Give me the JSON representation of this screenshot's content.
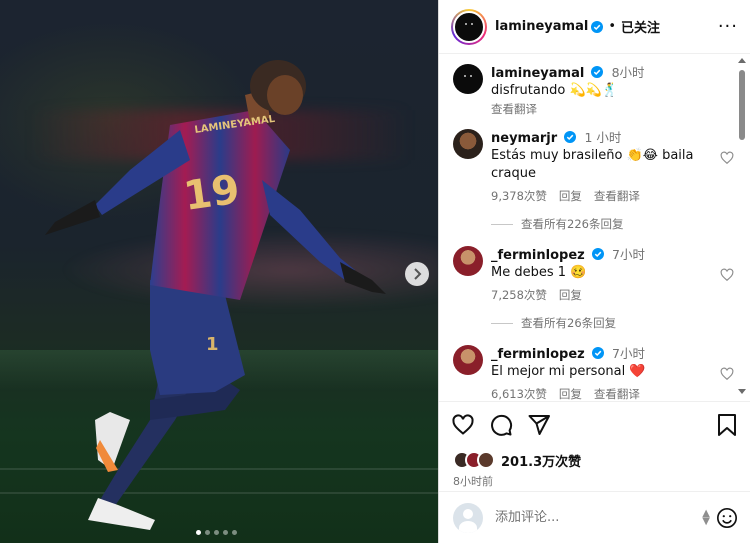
{
  "post": {
    "author": "lamineyamal",
    "follow_state": "已关注",
    "separator": "•",
    "more": "···",
    "jersey_name": "LAMINEYAMAL",
    "jersey_number": "19",
    "carousel": {
      "slides": 5,
      "active": 0
    }
  },
  "caption": {
    "user": "lamineyamal",
    "time": "8小时",
    "text": "disfrutando 💫💫🕺",
    "translate": "查看翻译"
  },
  "comments": [
    {
      "user": "neymarjr",
      "verified": true,
      "time": "1 小时",
      "text": "Estás muy brasileño 👏😂 baila craque",
      "likes": "9,378次赞",
      "reply": "回复",
      "translate": "查看翻译",
      "view_replies": "查看所有226条回复"
    },
    {
      "user": "_ferminlopez",
      "verified": true,
      "time": "7小时",
      "text": "Me debes 1 🥴",
      "likes": "7,258次赞",
      "reply": "回复",
      "view_replies": "查看所有26条回复"
    },
    {
      "user": "_ferminlopez",
      "verified": true,
      "time": "7小时",
      "text": "El mejor mi personal ❤️",
      "likes": "6,613次赞",
      "reply": "回复",
      "translate": "查看翻译"
    }
  ],
  "likes_count": "201.3万次赞",
  "posted_ago": "8小时前",
  "add_comment": {
    "placeholder": "添加评论..."
  },
  "colors": {
    "verified": "#0095f6",
    "heart_red": "#ed4956",
    "link_gray": "#737373"
  }
}
